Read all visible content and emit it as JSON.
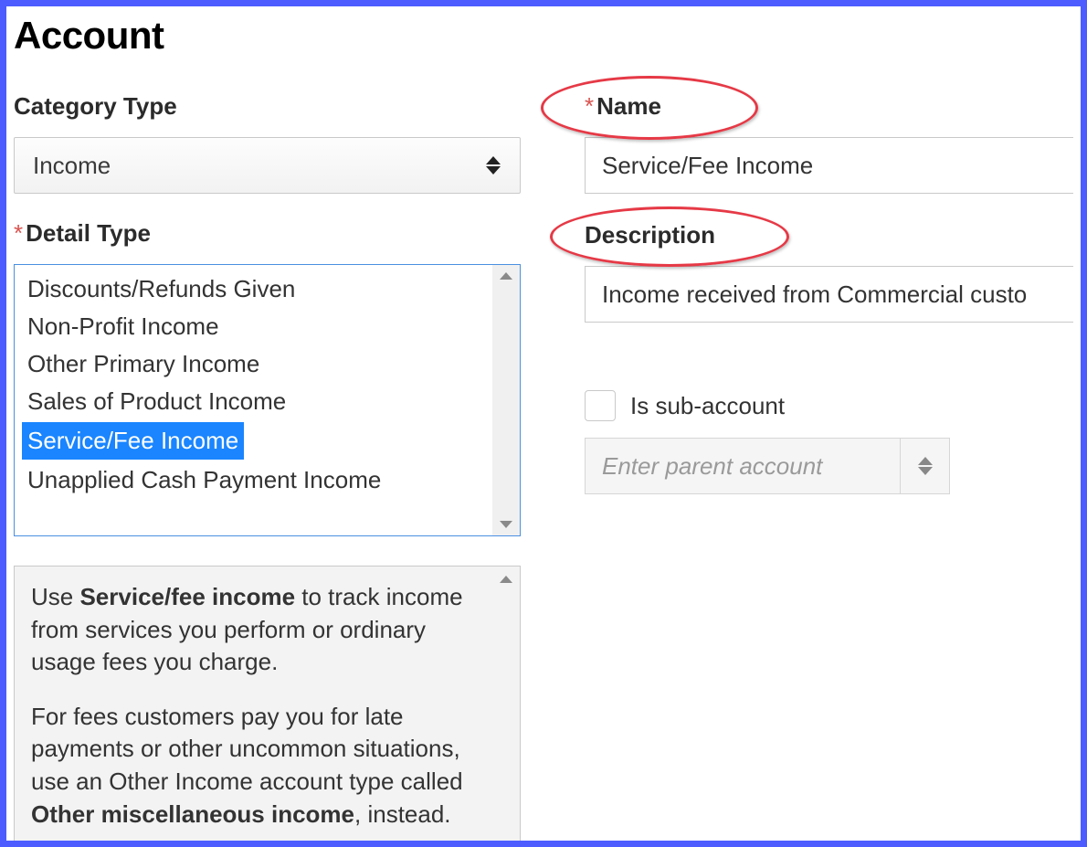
{
  "page_title": "Account",
  "left": {
    "category_type_label": "Category Type",
    "category_type_value": "Income",
    "detail_type_label": "Detail Type",
    "detail_items": [
      "Discounts/Refunds Given",
      "Non-Profit Income",
      "Other Primary Income",
      "Sales of Product Income",
      "Service/Fee Income",
      "Unapplied Cash Payment Income"
    ],
    "detail_selected_index": 4
  },
  "help": {
    "p1_prefix": "Use ",
    "p1_strong": "Service/fee income",
    "p1_suffix": " to track income from services you perform or ordinary usage fees you charge.",
    "p2_prefix": "For fees customers pay you for late payments or other uncommon situations, use an Other Income account type called ",
    "p2_strong": "Other miscellaneous income",
    "p2_suffix": ", instead."
  },
  "right": {
    "name_label": "Name",
    "name_value": "Service/Fee Income",
    "description_label": "Description",
    "description_value": "Income received from Commercial custo",
    "sub_account_label": "Is sub-account",
    "parent_placeholder": "Enter parent account"
  }
}
